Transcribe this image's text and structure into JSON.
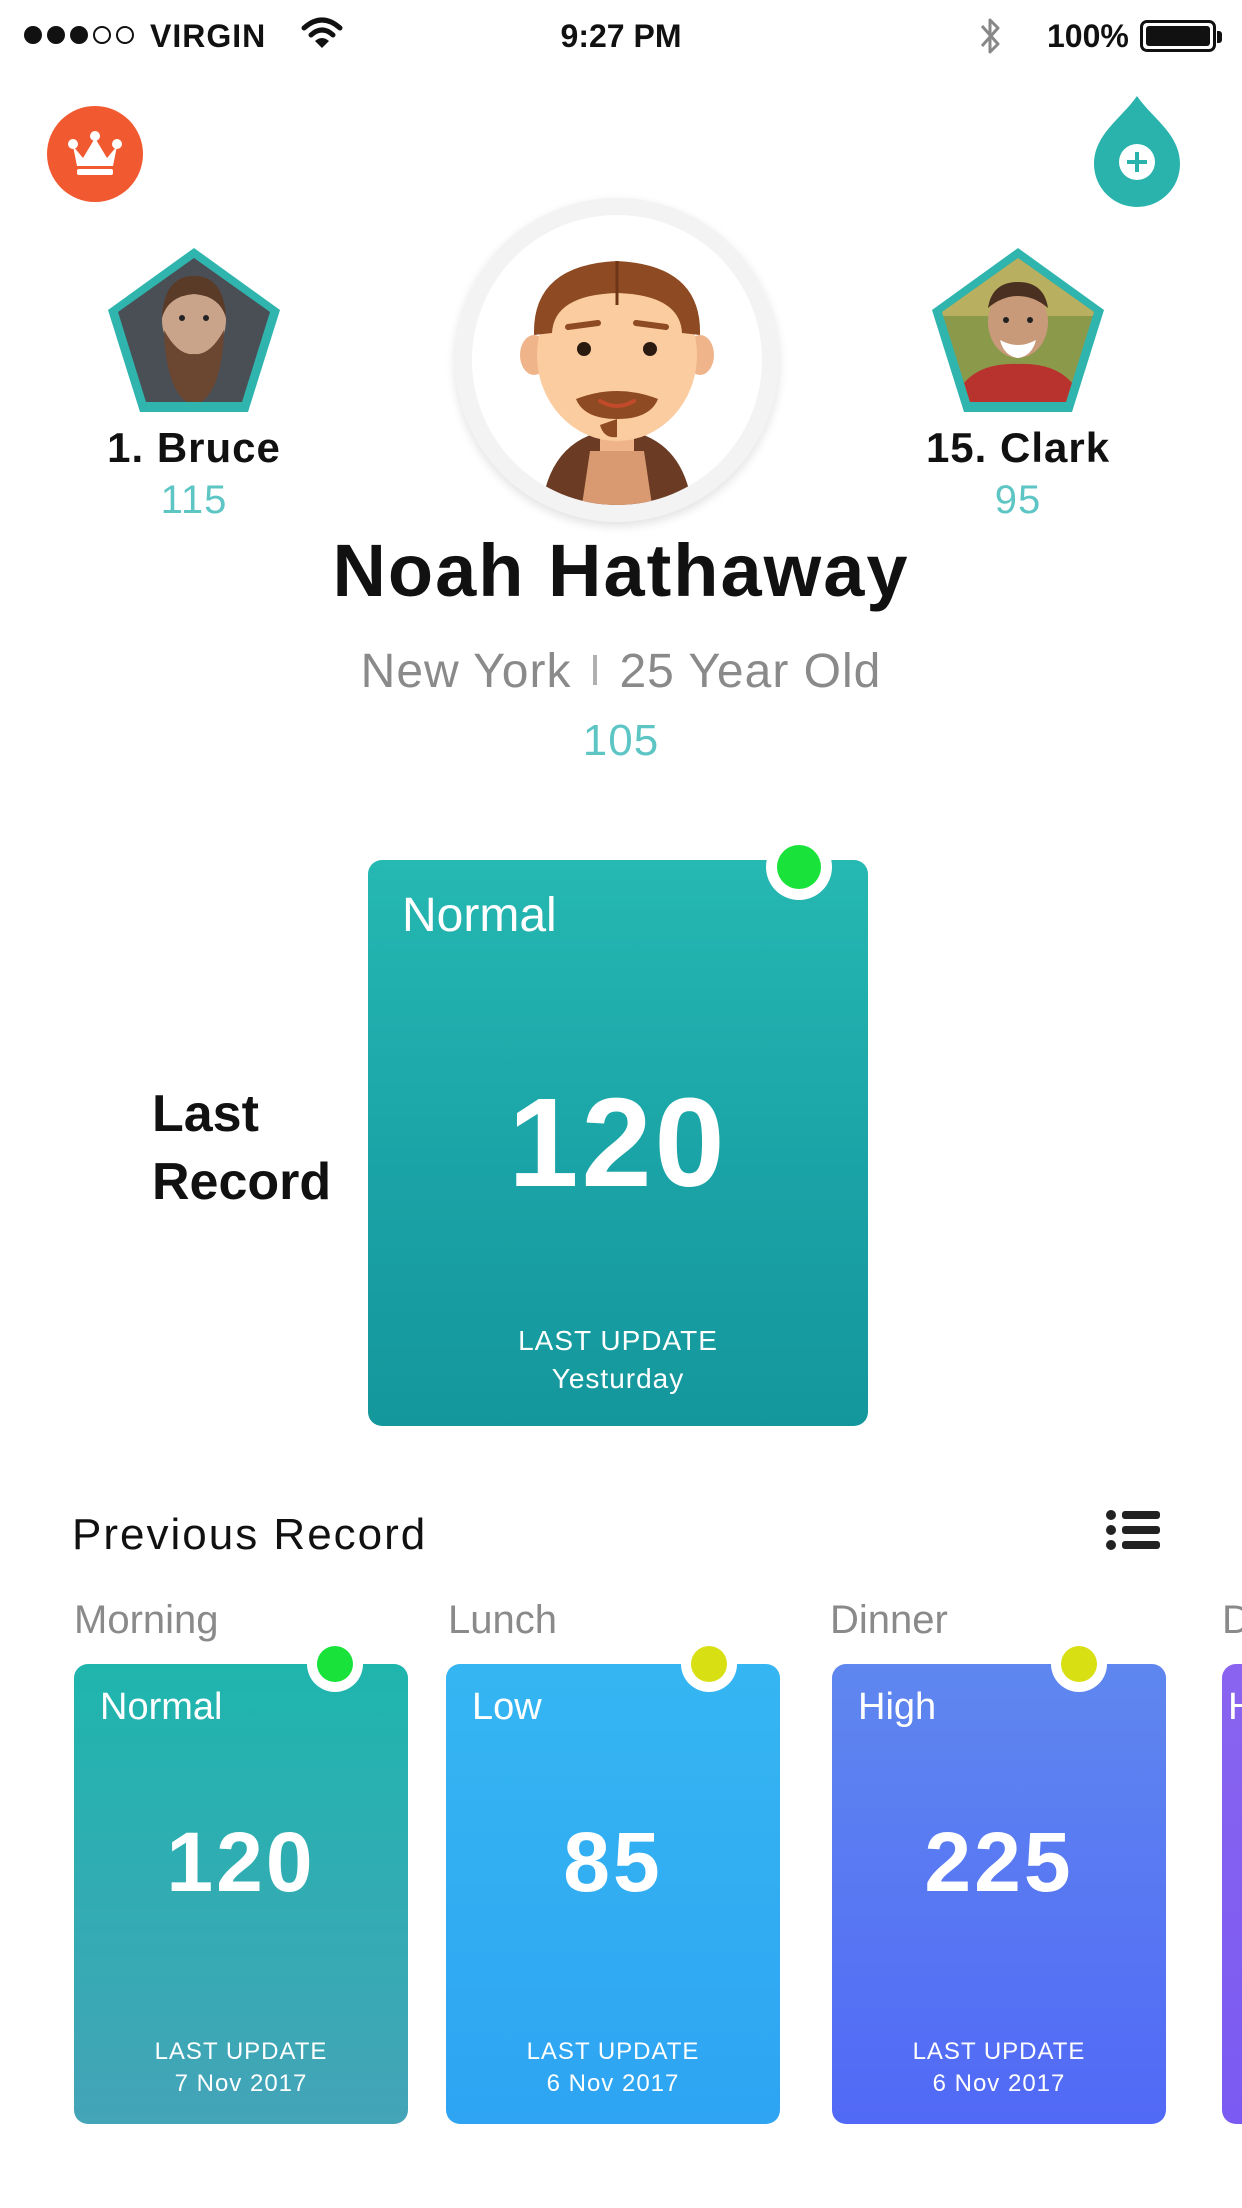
{
  "status_bar": {
    "carrier": "VIRGIN",
    "time": "9:27 PM",
    "battery": "100%",
    "signal_bars_filled": 3,
    "signal_bars_total": 5
  },
  "icons": {
    "crown": "crown-icon",
    "add": "add-drop-icon",
    "list": "list-icon",
    "accent_orange": "#f15a30",
    "accent_teal": "#2ab3ad"
  },
  "leaders": [
    {
      "rank_name": "1. Bruce",
      "score": "115"
    },
    {
      "rank_name": "15. Clark",
      "score": "95"
    }
  ],
  "profile": {
    "name": "Noah Hathaway",
    "city": "New York",
    "age": "25 Year Old",
    "score": "105"
  },
  "last_record": {
    "label_line1": "Last",
    "label_line2": "Record",
    "status": "Normal",
    "value": "120",
    "update_label": "LAST UPDATE",
    "update_value": "Yesturday",
    "indicator_color": "#19e23a"
  },
  "previous": {
    "title": "Previous Record",
    "cards": [
      {
        "meal": "Morning",
        "status": "Normal",
        "value": "120",
        "update_label": "LAST UPDATE",
        "date": "7 Nov 2017",
        "indicator_color": "#19e23a",
        "color_top": "#1fb5ad",
        "color_bottom": "#44a4b8"
      },
      {
        "meal": "Lunch",
        "status": "Low",
        "value": "85",
        "update_label": "LAST UPDATE",
        "date": "6 Nov 2017",
        "indicator_color": "#d8e014",
        "color_top": "#35b6f2",
        "color_bottom": "#2ea4f2"
      },
      {
        "meal": "Dinner",
        "status": "High",
        "value": "225",
        "update_label": "LAST UPDATE",
        "date": "6 Nov 2017",
        "indicator_color": "#d8e014",
        "color_top": "#5f87ef",
        "color_bottom": "#5169f6"
      },
      {
        "meal": "D",
        "status": "H",
        "color_top": "#8a64f0",
        "color_bottom": "#7a5af2"
      }
    ]
  }
}
